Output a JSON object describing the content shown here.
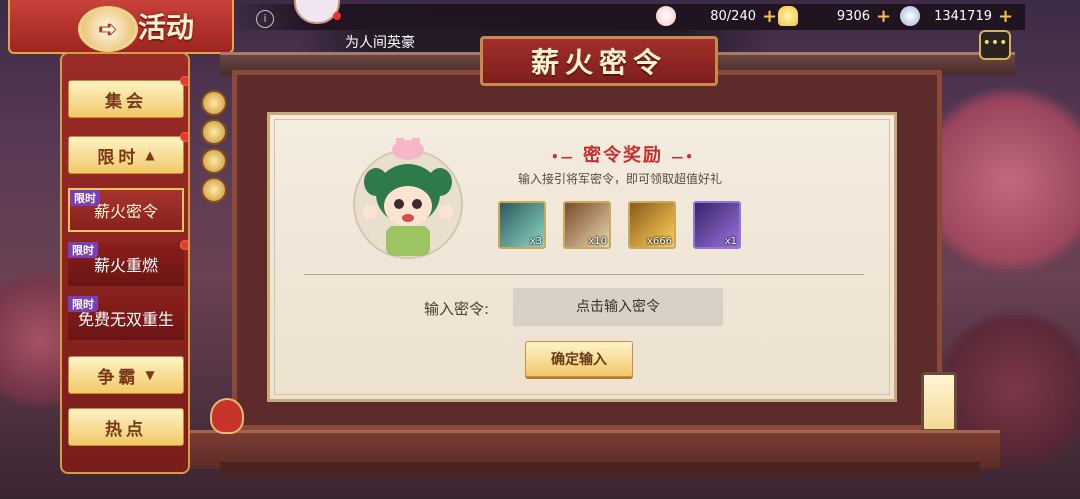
{
  "header": {
    "title": "活动",
    "back_icon": "back-arrow-icon",
    "info_icon": "i"
  },
  "resources": [
    {
      "name": "stamina",
      "value": "80/240",
      "icon": "peach-bun-icon",
      "color": "#f4c6c0"
    },
    {
      "name": "gold",
      "value": "9306",
      "icon": "gold-ingot-icon",
      "color": "#f3c240"
    },
    {
      "name": "silver",
      "value": "1341719",
      "icon": "silver-coin-icon",
      "color": "#9fb3d8"
    }
  ],
  "plus_label": "+",
  "ticker": {
    "text": "为人间英豪"
  },
  "chat_icon": "chat-bubble-icon",
  "sidebar": {
    "items": [
      {
        "label": "集会",
        "type": "category"
      },
      {
        "label": "限时",
        "type": "category",
        "expanded": true,
        "arrow": "▲"
      },
      {
        "label": "薪火密令",
        "type": "sub",
        "tag": "限时",
        "active": true
      },
      {
        "label": "薪火重燃",
        "type": "sub",
        "tag": "限时"
      },
      {
        "label": "免费无双重生",
        "type": "sub",
        "tag": "限时"
      },
      {
        "label": "争霸",
        "type": "category",
        "arrow": "▼"
      },
      {
        "label": "热点",
        "type": "category"
      }
    ]
  },
  "panel": {
    "title": "薪火密令",
    "reward_title": "密令奖励",
    "reward_subtitle": "输入接引将军密令，即可领取超值好礼",
    "rewards": [
      {
        "name": "jade-scroll",
        "qty": "x3",
        "colors": [
          "#2c5a5a",
          "#8ed6c8"
        ]
      },
      {
        "name": "summon-scroll",
        "qty": "x10",
        "colors": [
          "#7a4c2a",
          "#e8d6b0"
        ]
      },
      {
        "name": "gold-ingot",
        "qty": "x666",
        "colors": [
          "#8a5a1a",
          "#ffd35a"
        ]
      },
      {
        "name": "purple-token",
        "qty": "x1",
        "colors": [
          "#3a2466",
          "#9a72e0"
        ]
      }
    ],
    "input_label": "输入密令:",
    "input_placeholder": "点击输入密令",
    "confirm_label": "确定输入"
  },
  "colors": {
    "accent_red": "#c4302b",
    "gold": "#f1c967",
    "tag_purple": "#7a3fb2"
  }
}
